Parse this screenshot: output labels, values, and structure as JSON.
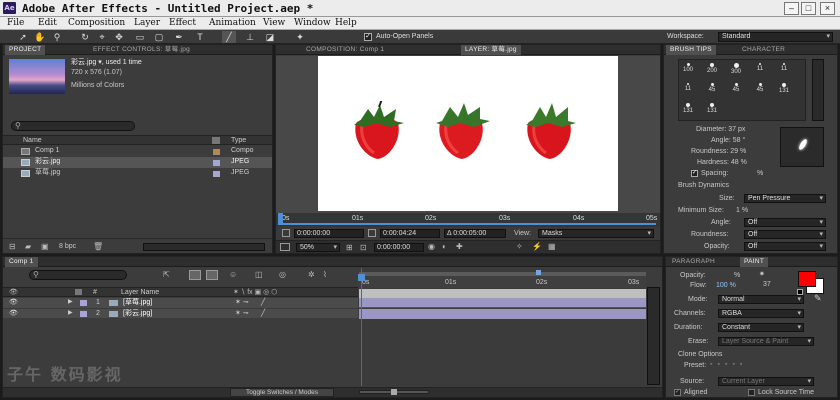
{
  "title_bar": {
    "app_icon": "Ae",
    "title": "Adobe After Effects - Untitled Project.aep *"
  },
  "menu": [
    "File",
    "Edit",
    "Composition",
    "Layer",
    "Effect",
    "Animation",
    "View",
    "Window",
    "Help"
  ],
  "toolbar": {
    "auto_open_panels": "Auto-Open Panels",
    "workspace_label": "Workspace:",
    "workspace_value": "Standard"
  },
  "project_panel": {
    "tabs": [
      "PROJECT",
      "EFFECT CONTROLS: 草莓.jpg"
    ],
    "preview_name": "彩云.jpg ▾, used 1 time",
    "preview_dims": "720 x 576 (1.07)",
    "preview_colors": "Millions of Colors",
    "search_placeholder": "",
    "col_name": "Name",
    "col_type": "Type",
    "items": [
      {
        "name": "Comp 1",
        "type": "Compo",
        "color": "#b08a5a"
      },
      {
        "name": "彩云.jpg",
        "type": "JPEG",
        "color": "#a6a6d4"
      },
      {
        "name": "草莓.jpg",
        "type": "JPEG",
        "color": "#a6a6d4"
      }
    ],
    "bpc": "8 bpc"
  },
  "viewer": {
    "tabs": [
      "COMPOSITION: Comp 1",
      "LAYER: 草莓.jpg"
    ],
    "ruler": [
      "0s",
      "01s",
      "02s",
      "03s",
      "04s",
      "05s"
    ],
    "time_current": "0:00:00:00",
    "time_end": "0:00:04:24",
    "time_duration": "Δ 0:00:05:00",
    "view_label": "View:",
    "view_value": "Masks",
    "zoom": "50%",
    "time_display": "0:00:00:00"
  },
  "brush_panel": {
    "tabs": [
      "BRUSH TIPS",
      "CHARACTER"
    ],
    "tips": [
      "100",
      "200",
      "300",
      "11",
      "11",
      "11",
      "45",
      "45",
      "45",
      "131",
      "131",
      "131"
    ],
    "diameter": "Diameter: 37 px",
    "angle": "Angle: 58 °",
    "roundness": "Roundness: 29 %",
    "hardness": "Hardness: 48 %",
    "spacing": "Spacing:",
    "spacing_unit": "%",
    "dynamics_title": "Brush Dynamics",
    "dyn": [
      {
        "label": "Size:",
        "value": "Pen Pressure"
      },
      {
        "label": "Minimum Size:",
        "value": "1 %"
      },
      {
        "label": "Angle:",
        "value": "Off"
      },
      {
        "label": "Roundness:",
        "value": "Off"
      },
      {
        "label": "Opacity:",
        "value": "Off"
      }
    ]
  },
  "paint_panel": {
    "tabs": [
      "PARAGRAPH",
      "PAINT"
    ],
    "opacity_label": "Opacity:",
    "opacity_unit": "%",
    "flow_label": "Flow:",
    "flow_value": "100 %",
    "brush_size": "37",
    "fg_color": "#ff0000",
    "bg_color": "#ffffff",
    "mode_label": "Mode:",
    "mode_value": "Normal",
    "channels_label": "Channels:",
    "channels_value": "RGBA",
    "duration_label": "Duration:",
    "duration_value": "Constant",
    "erase_label": "Erase:",
    "erase_value": "Layer Source & Paint",
    "clone_options": "Clone Options",
    "preset_label": "Preset:",
    "source_label": "Source:",
    "source_value": "Current Layer",
    "aligned": "Aligned",
    "lock_source_time": "Lock Source Time"
  },
  "timeline": {
    "tab": "Comp 1",
    "col_hash": "#",
    "col_layer": "Layer Name",
    "layers": [
      {
        "num": "1",
        "name": "[草莓.jpg]"
      },
      {
        "num": "2",
        "name": "[彩云.jpg]"
      }
    ],
    "ruler": [
      "0s",
      "01s",
      "02s",
      "03s"
    ],
    "toggle": "Toggle Switches / Modes",
    "watermark": "子午 数码影视"
  }
}
